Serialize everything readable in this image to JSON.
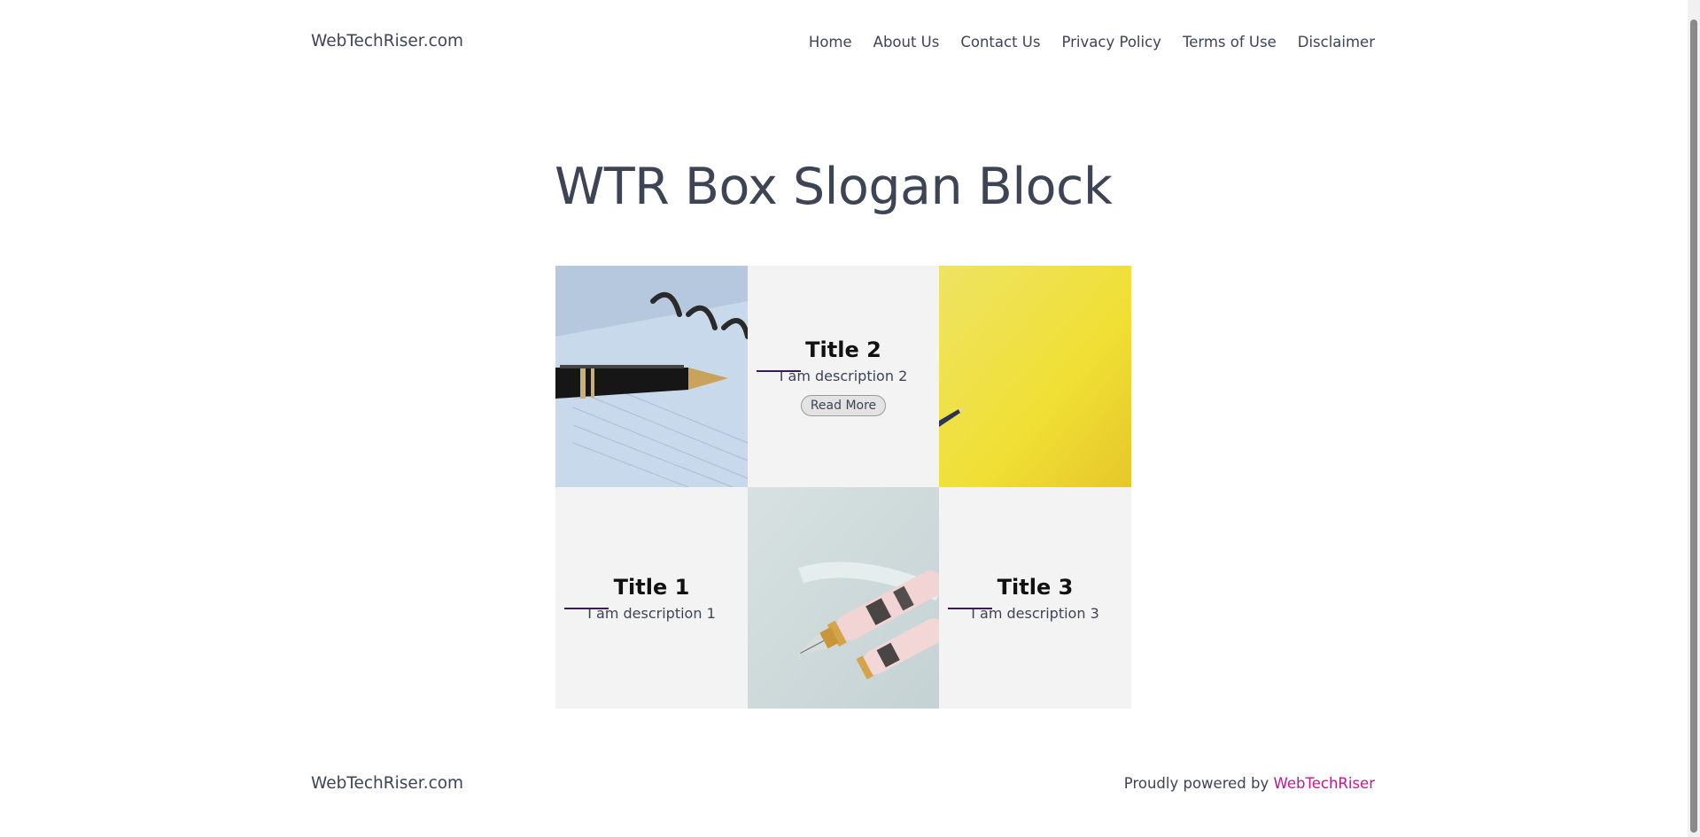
{
  "header": {
    "site_title": "WebTechRiser.com",
    "nav": [
      "Home",
      "About Us",
      "Contact Us",
      "Privacy Policy",
      "Terms of Use",
      "Disclaimer"
    ]
  },
  "main": {
    "title": "WTR Box Slogan Block",
    "boxes": [
      {
        "title": "Title 1",
        "description": "I am description 1"
      },
      {
        "title": "Title 2",
        "description": "I am description 2",
        "button": "Read More"
      },
      {
        "title": "Title 3",
        "description": "I am description 3"
      }
    ]
  },
  "footer": {
    "site_title": "WebTechRiser.com",
    "credit_prefix": "Proudly powered by",
    "credit_link": "WebTechRiser"
  },
  "colors": {
    "text": "#3c4456",
    "accent_link": "#c2188e",
    "box_bg": "#f3f3f3",
    "underline": "#3a1c57"
  }
}
